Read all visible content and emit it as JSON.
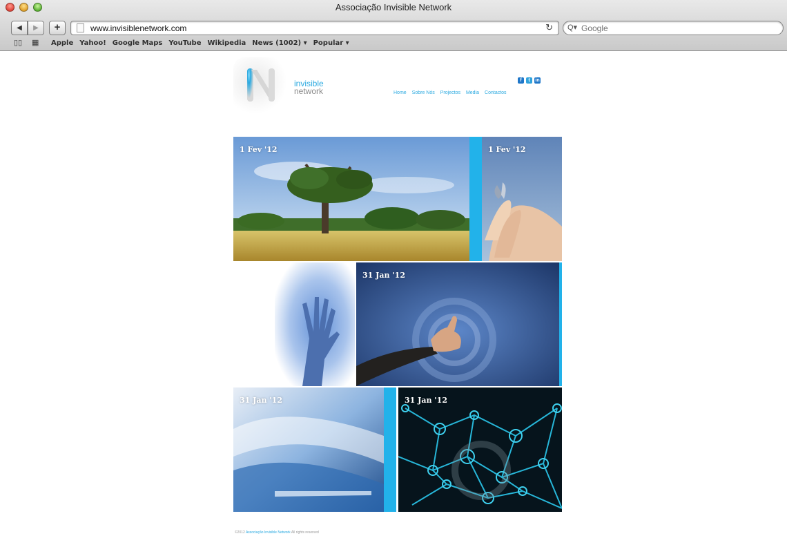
{
  "browser": {
    "window_title": "Associação Invisible Network",
    "url": "www.invisiblenetwork.com",
    "search_placeholder": "Google",
    "nav": {
      "back": "◀",
      "forward": "▶",
      "add": "+"
    },
    "bookmarks": [
      "Apple",
      "Yahoo!",
      "Google Maps",
      "YouTube",
      "Wikipedia",
      "News (1002) ▾",
      "Popular ▾"
    ]
  },
  "site": {
    "brand_line1": "invisible",
    "brand_line2": "network",
    "social": [
      "f",
      "t",
      "in"
    ],
    "nav": [
      "Home",
      "Sobre Nós",
      "Projectos",
      "Media",
      "Contactos"
    ],
    "accent_color": "#22b2ea"
  },
  "tiles": [
    {
      "date": "1 Fev '12",
      "subject": "tree in a meadow"
    },
    {
      "date": "1 Fev '12",
      "subject": "butterfly on a hand"
    },
    {
      "date": "",
      "subject": "hand pressed against glass"
    },
    {
      "date": "31 Jan '12",
      "subject": "finger pointing at target"
    },
    {
      "date": "31 Jan '12",
      "subject": "blurred blue glass"
    },
    {
      "date": "31 Jan '12",
      "subject": "network of nodes"
    }
  ],
  "footer": {
    "prefix": "©2012",
    "link": "Associação Invisible Network",
    "suffix": "All rights reserved"
  }
}
